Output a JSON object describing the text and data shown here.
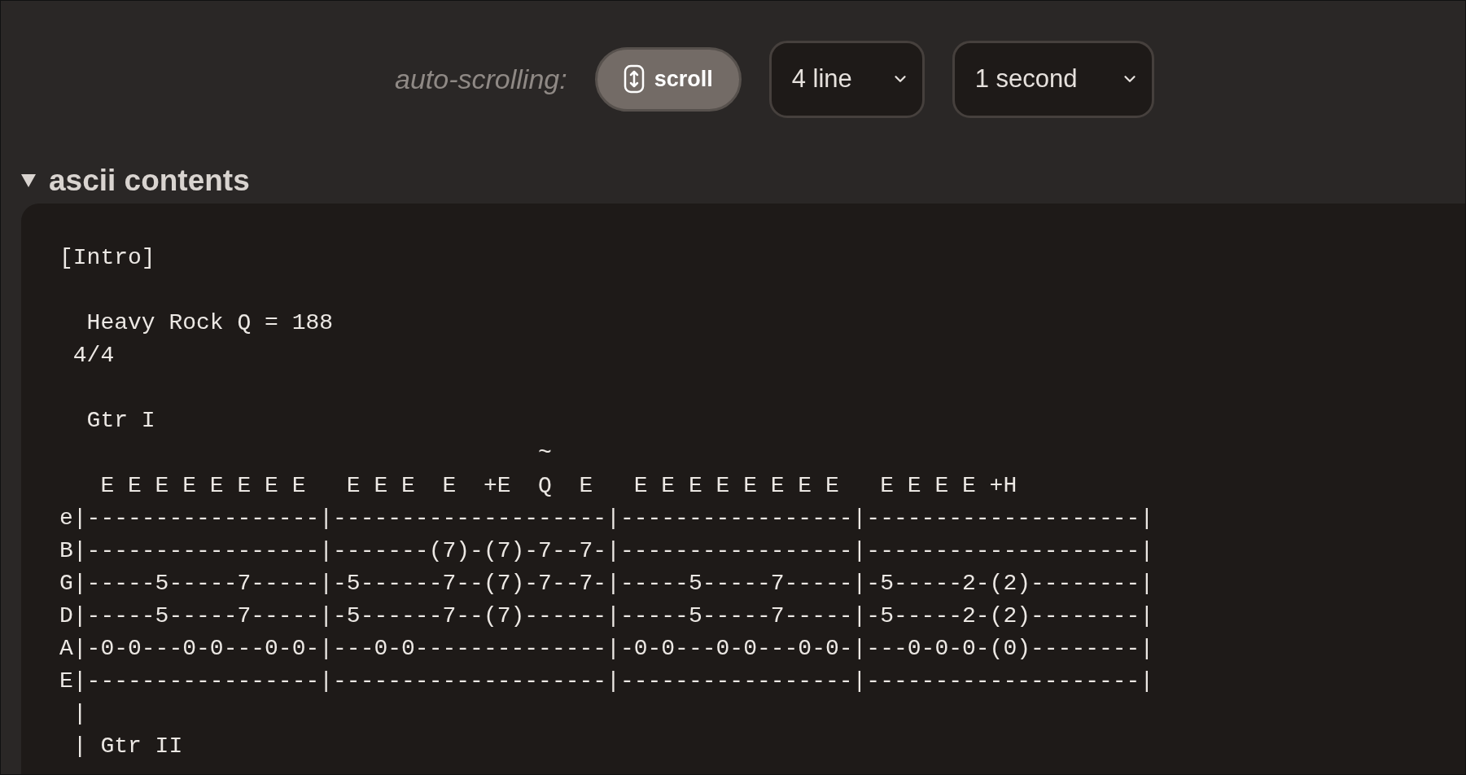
{
  "toolbar": {
    "label": "auto-scrolling:",
    "scroll_button": {
      "label": "scroll"
    },
    "selects": [
      {
        "value": "4 line"
      },
      {
        "value": "1 second"
      }
    ]
  },
  "section": {
    "title": "ascii contents",
    "expanded": true,
    "blocks": [
      [
        "[Intro]"
      ],
      [
        "  Heavy Rock Q = 188",
        " 4/4"
      ],
      [
        "  Gtr I",
        "                                   ~",
        "   E E E E E E E E   E E E  E  +E  Q  E   E E E E E E E E   E E E E +H",
        "e|-----------------|--------------------|-----------------|--------------------|",
        "B|-----------------|-------(7)-(7)-7--7-|-----------------|--------------------|",
        "G|-----5-----7-----|-5------7--(7)-7--7-|-----5-----7-----|-5-----2-(2)--------|",
        "D|-----5-----7-----|-5------7--(7)------|-----5-----7-----|-5-----2-(2)--------|",
        "A|-0-0---0-0---0-0-|---0-0--------------|-0-0---0-0---0-0-|---0-0-0-(0)--------|",
        "E|-----------------|--------------------|-----------------|--------------------|",
        " |",
        " | Gtr II"
      ]
    ]
  }
}
